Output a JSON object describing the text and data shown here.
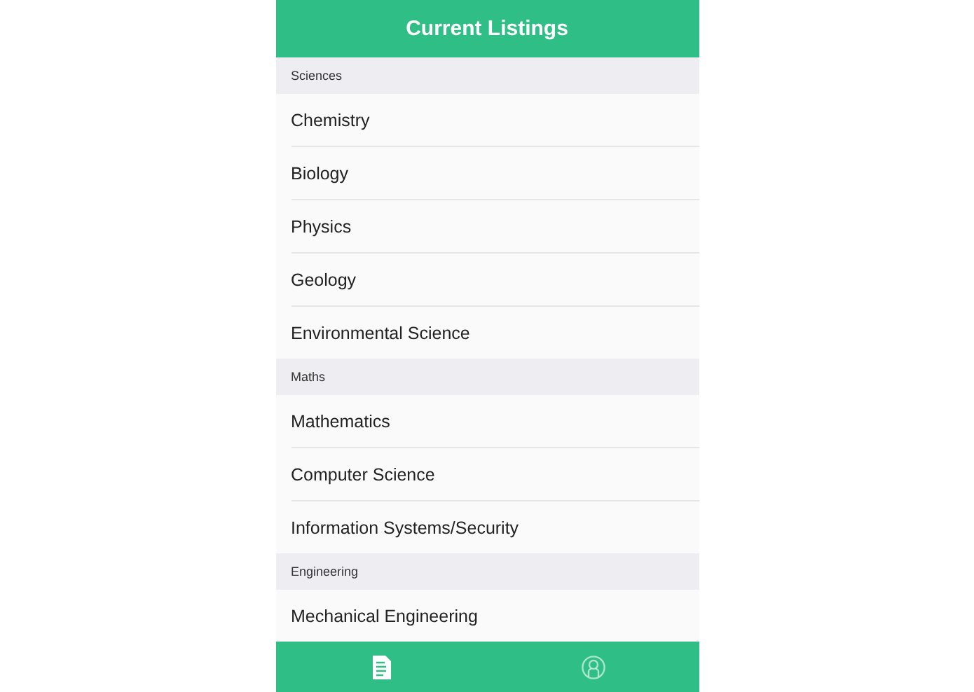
{
  "header": {
    "title": "Current Listings"
  },
  "sections": [
    {
      "title": "Sciences",
      "items": [
        "Chemistry",
        "Biology",
        "Physics",
        "Geology",
        "Environmental Science"
      ]
    },
    {
      "title": "Maths",
      "items": [
        "Mathematics",
        "Computer Science",
        "Information Systems/Security"
      ]
    },
    {
      "title": "Engineering",
      "items": [
        "Mechanical Engineering"
      ]
    }
  ],
  "tabs": [
    {
      "kind": "listings",
      "selected": true
    },
    {
      "kind": "profile",
      "selected": false
    }
  ]
}
